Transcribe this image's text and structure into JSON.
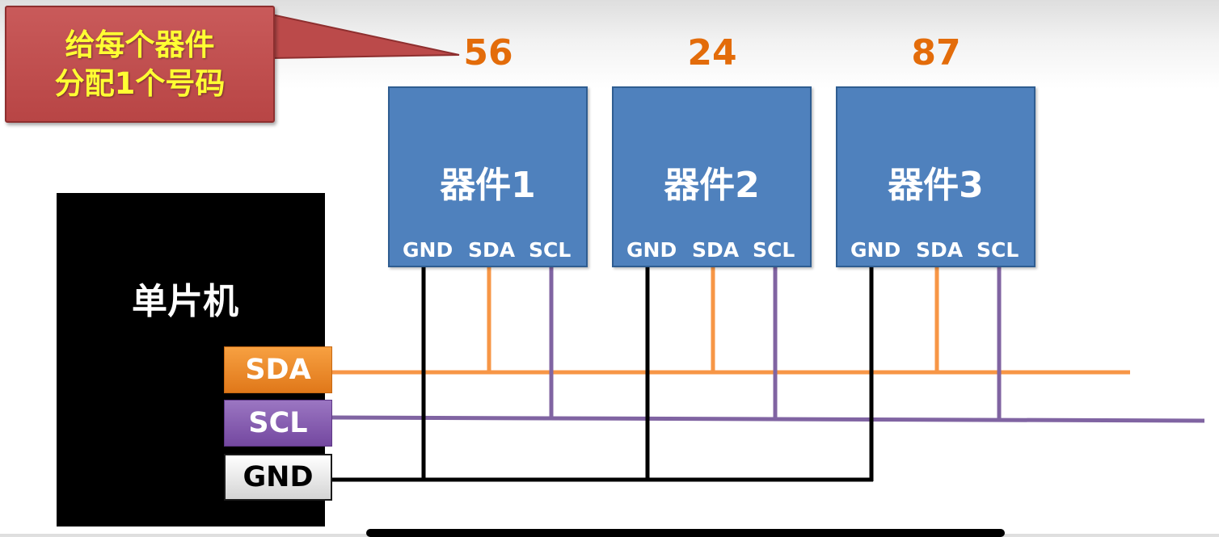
{
  "callout": {
    "line1": "给每个器件",
    "line2": "分配1个号码"
  },
  "devices": [
    {
      "address": "56",
      "name": "器件1",
      "pins": [
        "GND",
        "SDA",
        "SCL"
      ]
    },
    {
      "address": "24",
      "name": "器件2",
      "pins": [
        "GND",
        "SDA",
        "SCL"
      ]
    },
    {
      "address": "87",
      "name": "器件3",
      "pins": [
        "GND",
        "SDA",
        "SCL"
      ]
    }
  ],
  "mcu": {
    "name": "单片机",
    "pins": {
      "sda": "SDA",
      "scl": "SCL",
      "gnd": "GND"
    }
  },
  "colors": {
    "sda": "#f79646",
    "scl": "#8064a2",
    "gnd": "#000000",
    "device": "#4f81bd",
    "address": "#e36c0a",
    "callout": "#c0504d",
    "callout_text": "#ffff33"
  }
}
